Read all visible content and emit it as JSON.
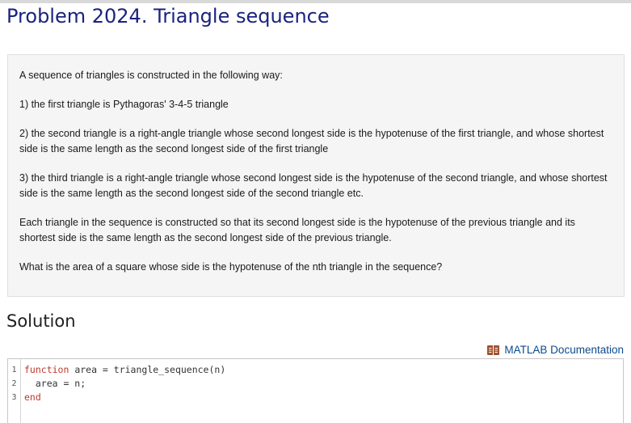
{
  "problem": {
    "title": "Problem 2024. Triangle sequence",
    "paragraphs": [
      "A sequence of triangles is constructed in the following way:",
      "1) the first triangle is Pythagoras' 3-4-5 triangle",
      "2) the second triangle is a right-angle triangle whose second longest side is the hypotenuse of the first triangle, and whose shortest side is the same length as the second longest side of the first triangle",
      "3) the third triangle is a right-angle triangle whose second longest side is the hypotenuse of the second triangle, and whose shortest side is the same length as the second longest side of the second triangle etc.",
      "Each triangle in the sequence is constructed so that its second longest side is the hypotenuse of the previous triangle and its shortest side is the same length as the second longest side of the previous triangle.",
      "What is the area of a square whose side is the hypotenuse of the nth triangle in the sequence?"
    ]
  },
  "solution": {
    "heading": "Solution",
    "doc_link": "MATLAB Documentation",
    "doc_icon": "book-icon",
    "code": {
      "line_numbers": [
        "1",
        "2",
        "3"
      ],
      "lines": [
        {
          "keyword": "function",
          "text": " area = triangle_sequence(n)"
        },
        {
          "keyword": "",
          "text": "  area = n;"
        },
        {
          "keyword": "end",
          "text": ""
        }
      ]
    }
  },
  "colors": {
    "title": "#1a237e",
    "link": "#0b4a8c",
    "keyword": "#c0392b",
    "icon": "#a0522d"
  }
}
